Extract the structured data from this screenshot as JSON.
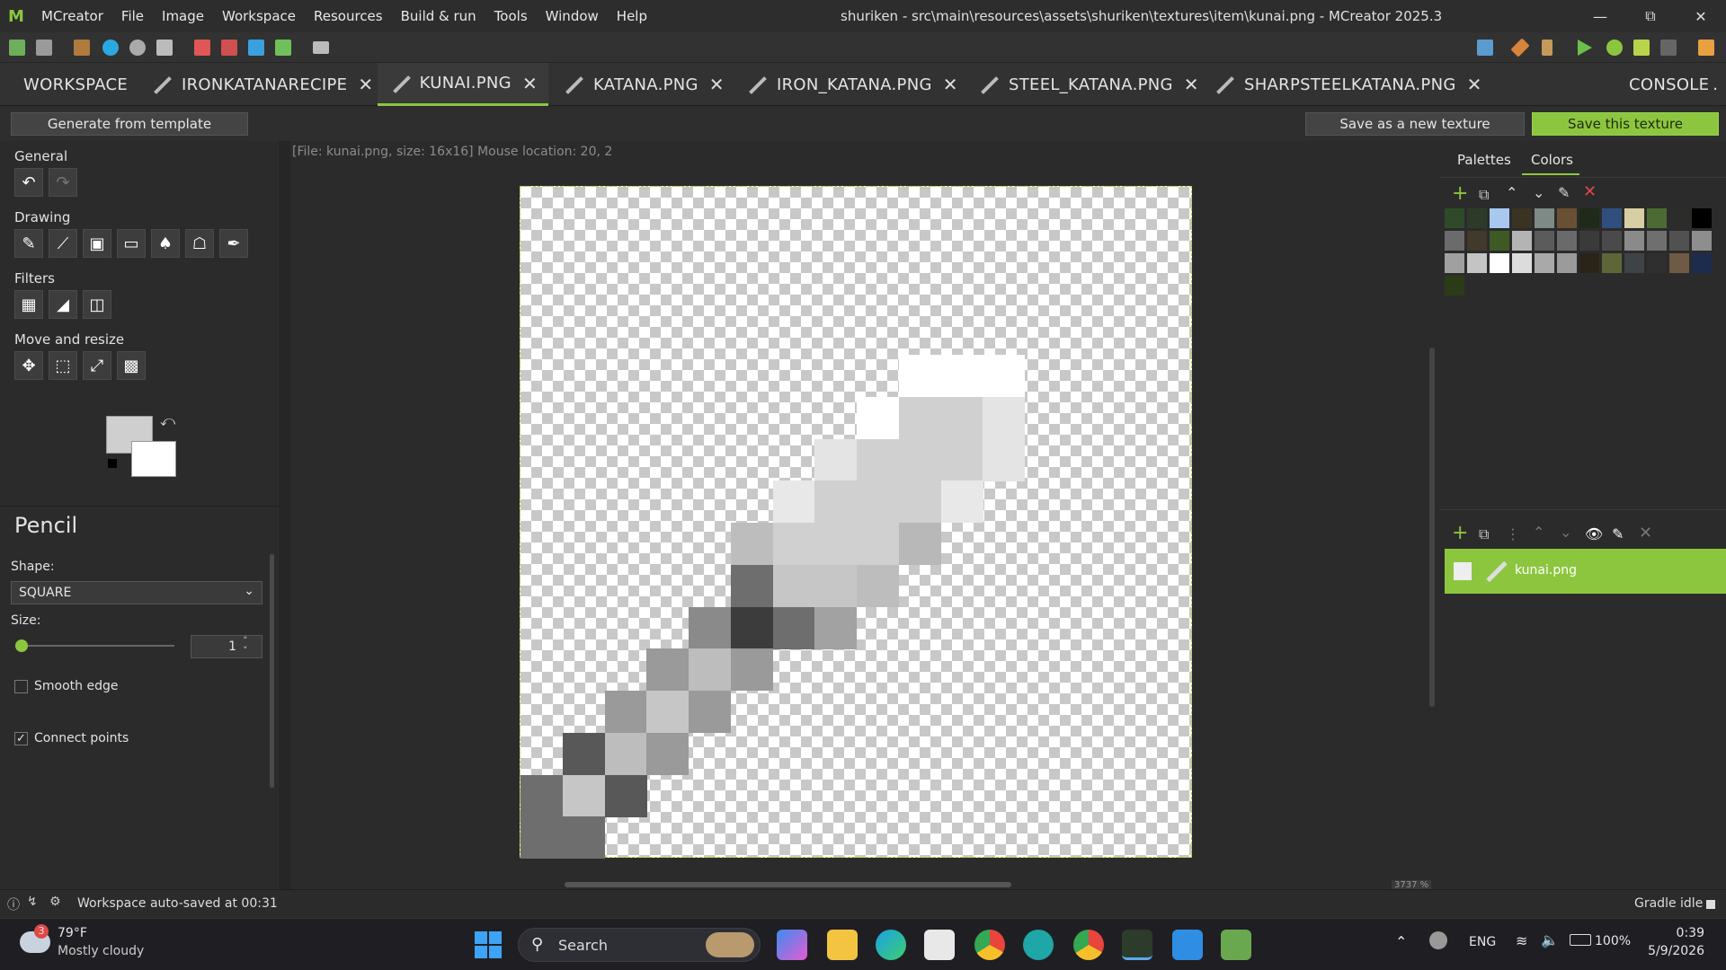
{
  "app": {
    "name": "MCreator",
    "window_title": "shuriken - src\\main\\resources\\assets\\shuriken\\textures\\item\\kunai.png - MCreator 2025.3"
  },
  "menu": [
    "MCreator",
    "File",
    "Image",
    "Workspace",
    "Resources",
    "Build & run",
    "Tools",
    "Window",
    "Help"
  ],
  "tabs": [
    {
      "label": "WORKSPACE"
    },
    {
      "label": "IRONKATANARECIPE"
    },
    {
      "label": "KUNAI.PNG",
      "active": true
    },
    {
      "label": "KATANA.PNG"
    },
    {
      "label": "IRON_KATANA.PNG"
    },
    {
      "label": "STEEL_KATANA.PNG"
    },
    {
      "label": "SHARPSTEELKATANA.PNG"
    },
    {
      "label": "CONSOLE"
    }
  ],
  "actions": {
    "generate": "Generate from template",
    "save_new": "Save as a new texture",
    "save": "Save this texture"
  },
  "tools": {
    "general": "General",
    "drawing": "Drawing",
    "filters": "Filters",
    "move": "Move and resize"
  },
  "tool_options": {
    "title": "Pencil",
    "shape_label": "Shape:",
    "shape_value": "SQUARE",
    "size_label": "Size:",
    "size_value": "1",
    "smooth_edge": "Smooth edge",
    "connect_points": "Connect points",
    "smooth_checked": false,
    "connect_checked": true
  },
  "canvas": {
    "info": "[File: kunai.png, size: 16x16] Mouse location: 20, 2",
    "zoom": "3737 %"
  },
  "right": {
    "palettes_tab": "Palettes",
    "colors_tab": "Colors",
    "layer_name": "kunai.png"
  },
  "palette_colors": [
    "#2f4a28",
    "#2e3a29",
    "#a9c8f0",
    "#3a3323",
    "#7e8a86",
    "#6a5033",
    "#1f2a18",
    "#304f7e",
    "#d7cfa4",
    "#4c6b34",
    "#2c2d2b",
    "#000000",
    "#6b6b6b",
    "#40392c",
    "#3d5a25",
    "#b4b4b4",
    "#5b5b5b",
    "#6a6a6a",
    "#3a3a3a",
    "#4a4a4a",
    "#8a8a8a",
    "#6f6f6f",
    "#515151",
    "#8e8e8e",
    "#a0a0a0",
    "#c4c4c4",
    "#ffffff",
    "#dcdcdc",
    "#a9a9a9",
    "#9b9b9b",
    "#2a2418",
    "#5e6536",
    "#3e4345",
    "#2f2f2f",
    "#6e5a46",
    "#1d2c4d",
    "#2b3b17"
  ],
  "status": {
    "autosave": "Workspace auto-saved at 00:31",
    "gradle": "Gradle idle"
  },
  "taskbar": {
    "weather_temp": "79°F",
    "weather_desc": "Mostly cloudy",
    "weather_badge": "3",
    "search": "Search",
    "lang": "ENG",
    "battery": "100%",
    "time": "0:39",
    "date": "5/9/2026"
  }
}
